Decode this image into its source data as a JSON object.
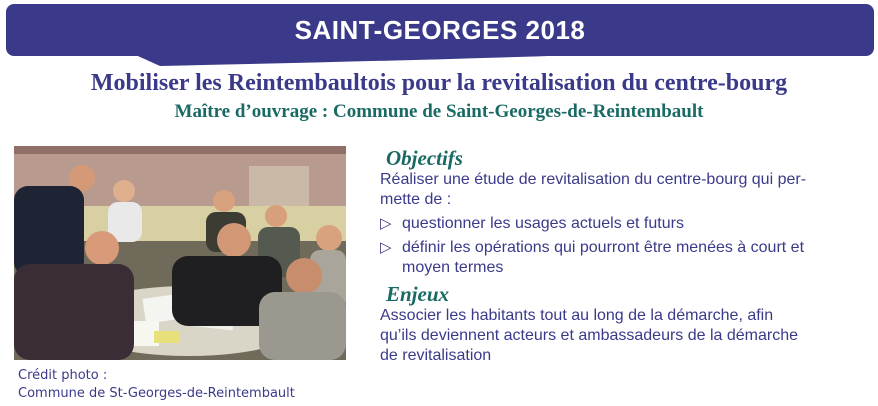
{
  "banner": {
    "title": "SAINT-GEORGES 2018"
  },
  "heading": {
    "title": "Mobiliser les Reintembaultois pour la revitalisation du centre-bourg",
    "subtitle": "Maître d’ouvrage : Commune de Saint-Georges-de-Reintembault"
  },
  "photo": {
    "credit_label": "Crédit photo :",
    "credit_source": "Commune de St-Georges-de-Reintembault"
  },
  "objectifs": {
    "heading": "Objectifs",
    "intro_line1": "Réaliser une étude de revitalisation du centre-bourg qui per-",
    "intro_line2": "mette de :",
    "bullets": [
      {
        "line1": "questionner les usages actuels et futurs",
        "line2": ""
      },
      {
        "line1": "définir  les opérations qui pourront être menées à court et",
        "line2": "moyen termes"
      }
    ]
  },
  "enjeux": {
    "heading": "Enjeux",
    "line1": "Associer les habitants tout au long de la démarche, afin",
    "line2": "qu’ils deviennent acteurs et ambassadeurs de la démarche",
    "line3": "de revitalisation"
  },
  "colors": {
    "brand": "#3b3a8a",
    "accent": "#1a6a64"
  },
  "icons": {
    "bullet": "triangle-right-outline-icon"
  }
}
